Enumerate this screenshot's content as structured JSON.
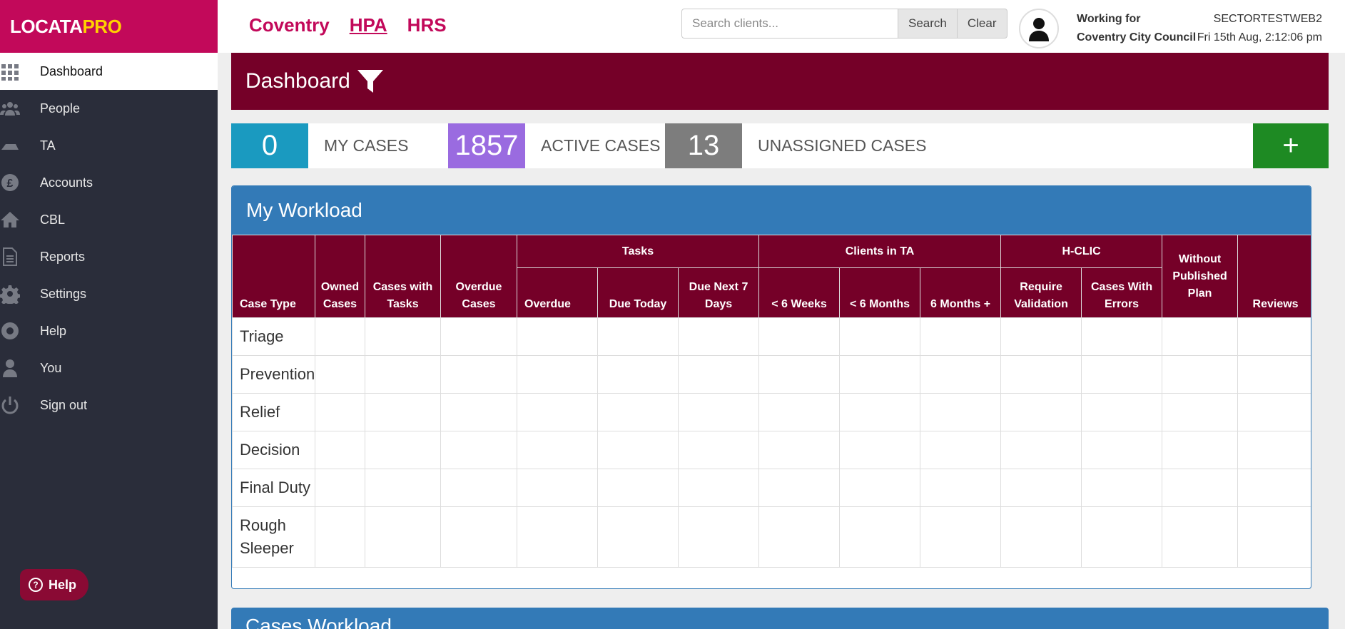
{
  "brand": {
    "logo_main": "LOCATA",
    "logo_pro": "PRO"
  },
  "sidebar": {
    "items": [
      {
        "label": "Dashboard",
        "icon": "grid-icon"
      },
      {
        "label": "People",
        "icon": "people-icon"
      },
      {
        "label": "TA",
        "icon": "ta-icon"
      },
      {
        "label": "Accounts",
        "icon": "pound-icon"
      },
      {
        "label": "CBL",
        "icon": "home-icon"
      },
      {
        "label": "Reports",
        "icon": "document-icon"
      },
      {
        "label": "Settings",
        "icon": "gear-icon"
      },
      {
        "label": "Help",
        "icon": "lifebuoy-icon"
      },
      {
        "label": "You",
        "icon": "user-icon"
      },
      {
        "label": "Sign out",
        "icon": "power-icon"
      }
    ],
    "help_button": "Help"
  },
  "topbar": {
    "orgs": [
      "Coventry",
      "HPA",
      "HRS"
    ],
    "search_placeholder": "Search clients...",
    "search_button": "Search",
    "clear_button": "Clear",
    "working_for_label": "Working for",
    "working_for_org": "Coventry City Council",
    "server": "SECTORTESTWEB2",
    "datetime": "Fri 15th Aug, 2:12:06 pm"
  },
  "dashboard": {
    "title": "Dashboard"
  },
  "counters": {
    "my_cases": {
      "value": "0",
      "label": "MY CASES",
      "color": "#1a9ac0"
    },
    "active_cases": {
      "value": "1857",
      "label": "ACTIVE CASES",
      "color": "#9a6be0"
    },
    "unassigned_cases": {
      "value": "13",
      "label": "UNASSIGNED CASES",
      "color": "#7d7d7d"
    },
    "add_button": "+"
  },
  "workload": {
    "title": "My Workload",
    "group_headers": {
      "tasks": "Tasks",
      "clients_in_ta": "Clients in TA",
      "hclic": "H-CLIC"
    },
    "columns": {
      "case_type": "Case Type",
      "owned": "Owned Cases",
      "with_tasks": "Cases with Tasks",
      "overdue_cases": "Overdue Cases",
      "overdue": "Overdue",
      "due_today": "Due Today",
      "due_next7": "Due Next 7 Days",
      "lt6w": "< 6 Weeks",
      "lt6m": "< 6 Months",
      "6mplus": "6 Months +",
      "require_validation": "Require Validation",
      "cases_with_errors": "Cases With Errors",
      "without_plan": "Without Published Plan",
      "reviews": "Reviews"
    },
    "rows": [
      "Triage",
      "Prevention",
      "Relief",
      "Decision",
      "Final Duty",
      "Rough Sleeper"
    ]
  },
  "cases_workload": {
    "title": "Cases Workload"
  }
}
